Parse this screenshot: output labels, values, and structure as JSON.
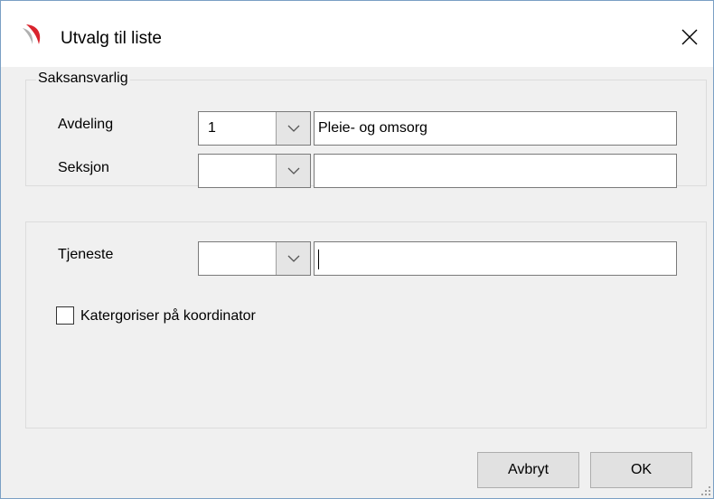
{
  "window": {
    "title": "Utvalg til liste",
    "close_glyph": "✕",
    "app_icon": "app-logo-icon"
  },
  "group_saksansvarlig": {
    "legend": "Saksansvarlig",
    "avdeling": {
      "label": "Avdeling",
      "code": "1",
      "name": "Pleie- og omsorg"
    },
    "seksjon": {
      "label": "Seksjon",
      "code": "",
      "name": ""
    }
  },
  "group_tjeneste": {
    "tjeneste": {
      "label": "Tjeneste",
      "code": "",
      "name": ""
    },
    "checkbox_label": "Katergoriser på koordinator",
    "checkbox_checked": false
  },
  "buttons": {
    "cancel": "Avbryt",
    "ok": "OK"
  },
  "colors": {
    "accent_icon": "#d9232d",
    "window_border": "#7a9fc4"
  }
}
